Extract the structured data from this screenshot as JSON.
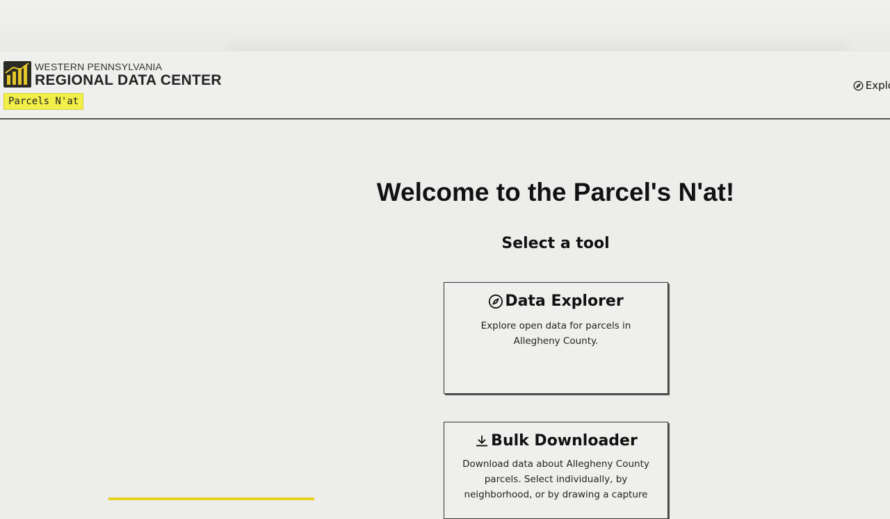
{
  "header": {
    "org_line1": "WESTERN PENNSYLVANIA",
    "org_line2": "REGIONAL DATA CENTER",
    "app_badge": "Parcels N'at",
    "nav": {
      "explorer_label": "Explo"
    }
  },
  "main": {
    "title": "Welcome to the Parcel's N'at!",
    "subtitle": "Select a tool",
    "tools": [
      {
        "title": "Data Explorer",
        "icon": "compass-icon",
        "description": "Explore open data for parcels in Allegheny County."
      },
      {
        "title": "Bulk Downloader",
        "icon": "download-icon",
        "description": "Download data about Allegheny County parcels. Select individually, by neighborhood, or by drawing a capture"
      }
    ]
  },
  "colors": {
    "background": "#ededeb",
    "badge": "#f2ef4a",
    "accent_bar": "#e7d020",
    "logo": "#2b2b25",
    "logo_accent": "#e3c62a"
  }
}
